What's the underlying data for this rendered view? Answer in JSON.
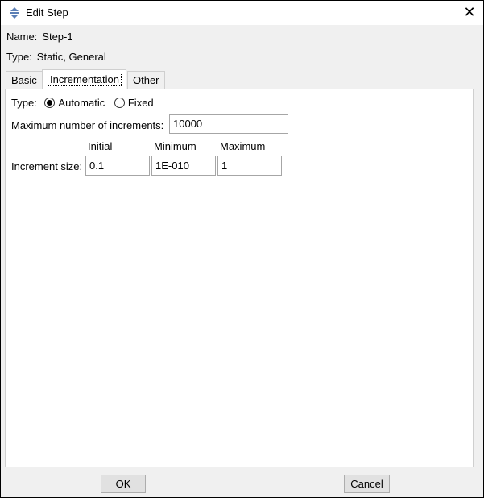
{
  "window": {
    "title": "Edit Step",
    "close_glyph": "✕"
  },
  "info": {
    "name_label": "Name:",
    "name_value": "Step-1",
    "type_label": "Type:",
    "type_value": "Static, General"
  },
  "tabs": [
    {
      "label": "Basic",
      "active": false
    },
    {
      "label": "Incrementation",
      "active": true
    },
    {
      "label": "Other",
      "active": false
    }
  ],
  "incrementation": {
    "type_label": "Type:",
    "options": [
      {
        "label": "Automatic",
        "checked": true
      },
      {
        "label": "Fixed",
        "checked": false
      }
    ],
    "max_increments_label": "Maximum number of increments:",
    "max_increments_value": "10000",
    "columns": [
      "Initial",
      "Minimum",
      "Maximum"
    ],
    "increment_size_label": "Increment size:",
    "increment_size_values": [
      "0.1",
      "1E-010",
      "1"
    ]
  },
  "buttons": {
    "ok": "OK",
    "cancel": "Cancel"
  },
  "icons": {
    "app": "abaqus-step-icon",
    "close": "close-icon"
  }
}
